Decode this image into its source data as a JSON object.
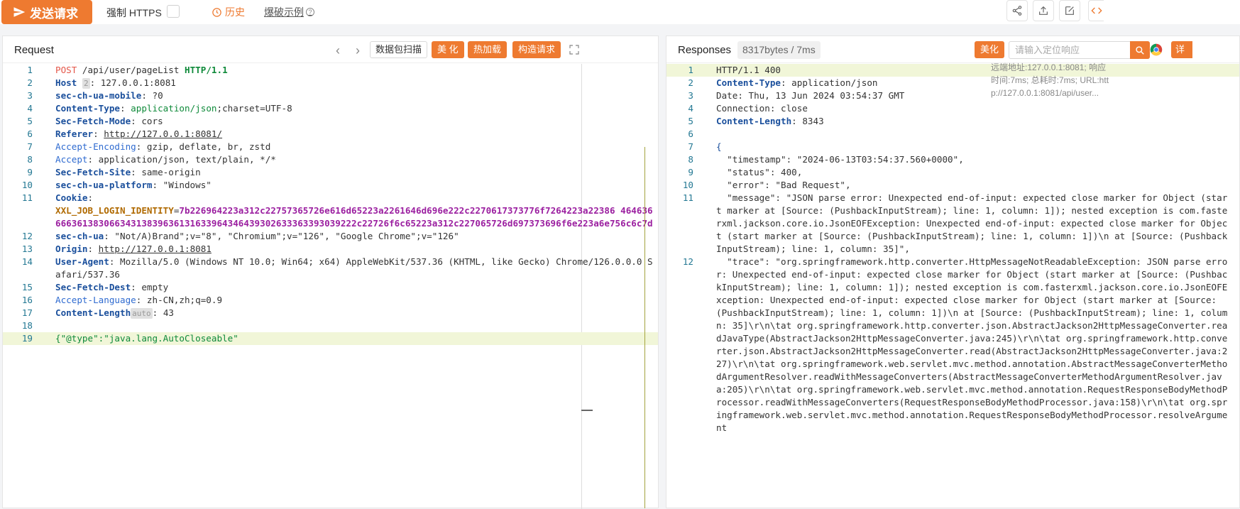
{
  "toolbar": {
    "send_label": "发送请求",
    "https_label": "强制 HTTPS",
    "history_label": "历史",
    "example_label": "爆破示例",
    "question_mark": "?"
  },
  "request": {
    "title": "Request",
    "scan_label": "数据包扫描",
    "beautify_label": "美 化",
    "hotload_label": "热加载",
    "build_label": "构造请求",
    "lines": [
      {
        "n": "1"
      },
      {
        "n": "2"
      },
      {
        "n": "3"
      },
      {
        "n": "4"
      },
      {
        "n": "5"
      },
      {
        "n": "6"
      },
      {
        "n": "7"
      },
      {
        "n": "8"
      },
      {
        "n": "9"
      },
      {
        "n": "10"
      },
      {
        "n": "11"
      },
      {
        "n": "12"
      },
      {
        "n": "13"
      },
      {
        "n": "14"
      },
      {
        "n": "15"
      },
      {
        "n": "16"
      },
      {
        "n": "17"
      },
      {
        "n": "18"
      },
      {
        "n": "19"
      }
    ],
    "method": "POST",
    "path": " /api/user/pageList ",
    "version": "HTTP/1.1",
    "host_key": "Host",
    "host_tag": "2",
    "host_val": ": 127.0.0.1:8081",
    "mobile_key": "sec-ch-ua-mobile",
    "mobile_val": ": ?0",
    "ctype_key": "Content-Type",
    "ctype_sep": ": ",
    "ctype_val": "application/json",
    "ctype_rest": ";charset=UTF-8",
    "fetchmode_key": "Sec-Fetch-Mode",
    "fetchmode_val": ": cors",
    "referer_key": "Referer",
    "referer_sep": ": ",
    "referer_val": "http://127.0.0.1:8081/",
    "encoding_key": "Accept-Encoding",
    "encoding_val": ": gzip, deflate, br, zstd",
    "accept_key": "Accept",
    "accept_val": ": application/json, text/plain, */*",
    "fetchsite_key": "Sec-Fetch-Site",
    "fetchsite_val": ": same-origin",
    "platform_key": "sec-ch-ua-platform",
    "platform_val": ": \"Windows\"",
    "cookie_key": "Cookie",
    "cookie_sep": ":",
    "cookie_name": "XXL_JOB_LOGIN_IDENTITY",
    "cookie_eq": "=",
    "cookie_val": "7b226964223a312c22757365726e616d65223a2261646d696e222c2270617373776f7264223a22386 46463666636138306634313839636131633964346439302633363393039222c22726f6c65223a312c227065726d697373696f6e223a6e756c6c7d",
    "secua_key": "sec-ch-ua",
    "secua_val": ": \"Not/A)Brand\";v=\"8\", \"Chromium\";v=\"126\", \"Google Chrome\";v=\"126\"",
    "origin_key": "Origin",
    "origin_sep": ": ",
    "origin_val": "http://127.0.0.1:8081",
    "ua_key": "User-Agent",
    "ua_val": ": Mozilla/5.0 (Windows NT 10.0; Win64; x64) AppleWebKit/537.36 (KHTML, like Gecko) Chrome/126.0.0.0 Safari/537.36",
    "fetchdest_key": "Sec-Fetch-Dest",
    "fetchdest_val": ": empty",
    "lang_key": "Accept-Language",
    "lang_val": ": zh-CN,zh;q=0.9",
    "clen_key": "Content-Length",
    "clen_tag": "auto",
    "clen_val": ": 43",
    "body": "{\"@type\":\"java.lang.AutoCloseable\""
  },
  "response": {
    "title": "Responses",
    "size_label": "8317bytes / 7ms",
    "beautify_label": "美化",
    "search_placeholder": "请输入定位响应",
    "detail_label": "详",
    "meta_text": "远端地址:127.0.0.1:8081; 响应时间:7ms; 总耗时:7ms; URL:http://127.0.0.1:8081/api/user...",
    "status_line": "HTTP/1.1 400",
    "ctype_key": "Content-Type",
    "ctype_val": ": application/json",
    "date_line": "Date: Thu, 13 Jun 2024 03:54:37 GMT",
    "conn_line": "Connection: close",
    "clen_key": "Content-Length",
    "clen_val": ": 8343",
    "brace": "{",
    "timestamp_line": "  \"timestamp\": \"2024-06-13T03:54:37.560+0000\",",
    "status_json": "  \"status\": 400,",
    "error_json": "  \"error\": \"Bad Request\",",
    "message_json": "  \"message\": \"JSON parse error: Unexpected end-of-input: expected close marker for Object (start marker at [Source: (PushbackInputStream); line: 1, column: 1]); nested exception is com.fasterxml.jackson.core.io.JsonEOFException: Unexpected end-of-input: expected close marker for Object (start marker at [Source: (PushbackInputStream); line: 1, column: 1])\\n at [Source: (PushbackInputStream); line: 1, column: 35]\",",
    "trace_json": "  \"trace\": \"org.springframework.http.converter.HttpMessageNotReadableException: JSON parse error: Unexpected end-of-input: expected close marker for Object (start marker at [Source: (PushbackInputStream); line: 1, column: 1]); nested exception is com.fasterxml.jackson.core.io.JsonEOFException: Unexpected end-of-input: expected close marker for Object (start marker at [Source: (PushbackInputStream); line: 1, column: 1])\\n at [Source: (PushbackInputStream); line: 1, column: 35]\\r\\n\\tat org.springframework.http.converter.json.AbstractJackson2HttpMessageConverter.readJavaType(AbstractJackson2HttpMessageConverter.java:245)\\r\\n\\tat org.springframework.http.converter.json.AbstractJackson2HttpMessageConverter.read(AbstractJackson2HttpMessageConverter.java:227)\\r\\n\\tat org.springframework.web.servlet.mvc.method.annotation.AbstractMessageConverterMethodArgumentResolver.readWithMessageConverters(AbstractMessageConverterMethodArgumentResolver.java:205)\\r\\n\\tat org.springframework.web.servlet.mvc.method.annotation.RequestResponseBodyMethodProcessor.readWithMessageConverters(RequestResponseBodyMethodProcessor.java:158)\\r\\n\\tat org.springframework.web.servlet.mvc.method.annotation.RequestResponseBodyMethodProcessor.resolveArgument",
    "line_numbers": [
      "1",
      "2",
      "3",
      "4",
      "5",
      "6",
      "7",
      "8",
      "9",
      "10",
      "11",
      "12"
    ]
  },
  "colors": {
    "accent": "#ee7a30"
  },
  "icons": [
    "send-icon",
    "clock-icon",
    "share-icon",
    "upload-icon",
    "edit-icon",
    "code-icon",
    "chevron-left-icon",
    "chevron-right-icon",
    "expand-icon",
    "search-icon",
    "chrome-icon"
  ]
}
